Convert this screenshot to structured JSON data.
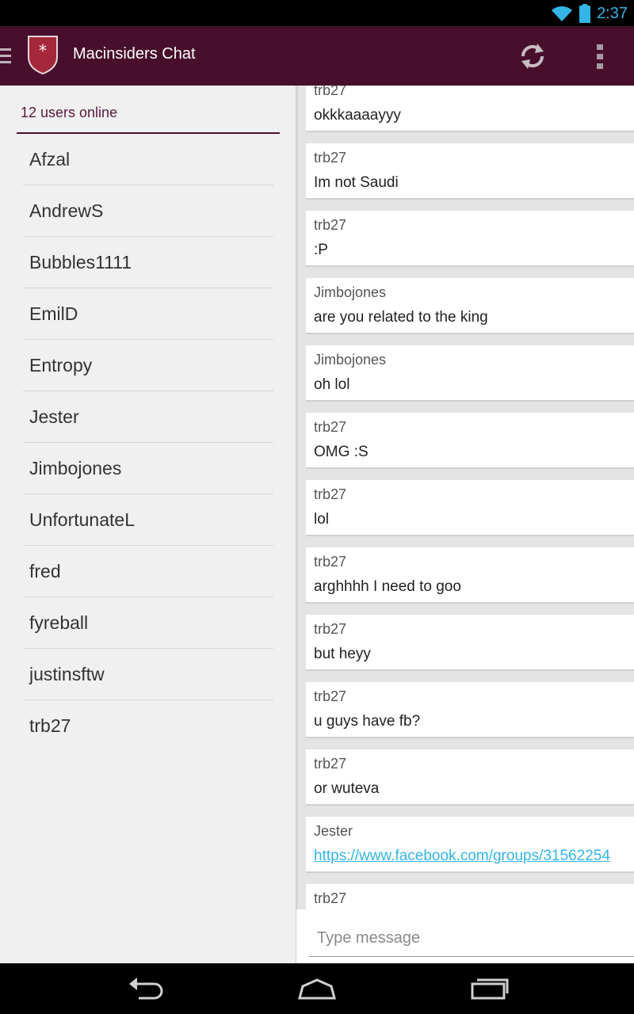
{
  "status": {
    "time": "2:37"
  },
  "app": {
    "title": "Macinsiders Chat"
  },
  "users": {
    "header": "12 users online",
    "list": [
      "Afzal",
      "AndrewS",
      "Bubbles1111",
      "EmilD",
      "Entropy",
      "Jester",
      "Jimbojones",
      "UnfortunateL",
      "fred",
      "fyreball",
      "justinsftw",
      "trb27"
    ]
  },
  "messages": [
    {
      "user": "trb27",
      "text": "okkkaaaayyy"
    },
    {
      "user": "trb27",
      "text": "Im not Saudi"
    },
    {
      "user": "trb27",
      "text": ":P"
    },
    {
      "user": "Jimbojones",
      "text": "are you related to the king"
    },
    {
      "user": "Jimbojones",
      "text": "oh lol"
    },
    {
      "user": "trb27",
      "text": "OMG :S"
    },
    {
      "user": "trb27",
      "text": "lol"
    },
    {
      "user": "trb27",
      "text": "arghhhh I need to goo"
    },
    {
      "user": "trb27",
      "text": "but heyy"
    },
    {
      "user": "trb27",
      "text": "u guys have fb?"
    },
    {
      "user": "trb27",
      "text": "or wuteva"
    },
    {
      "user": "Jester",
      "text": "https://www.facebook.com/groups/31562254"
    },
    {
      "user": "trb27",
      "text": ""
    }
  ],
  "input": {
    "placeholder": "Type message"
  },
  "colors": {
    "actionbar": "#470f2c",
    "accent": "#33b5e5"
  }
}
